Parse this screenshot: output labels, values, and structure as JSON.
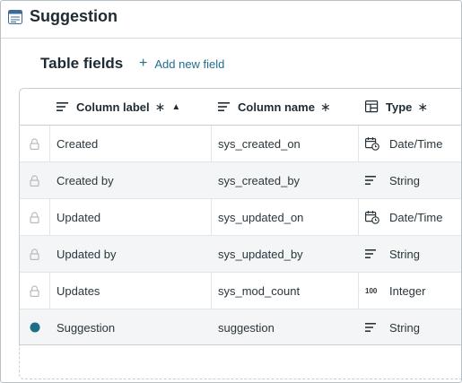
{
  "app": {
    "title": "Suggestion",
    "icon": "table-icon"
  },
  "section": {
    "title": "Table fields",
    "add_label": "Add new field"
  },
  "columns": {
    "label": {
      "text": "Column label",
      "required": "∗",
      "sort": "▲"
    },
    "name": {
      "text": "Column name",
      "required": "∗"
    },
    "type": {
      "text": "Type",
      "required": "∗"
    }
  },
  "rows": [
    {
      "status": "lock-icon",
      "label": "Created",
      "name": "sys_created_on",
      "type": "Date/Time",
      "type_icon": "calendar-clock-icon"
    },
    {
      "status": "lock-icon",
      "label": "Created by",
      "name": "sys_created_by",
      "type": "String",
      "type_icon": "text-lines-icon"
    },
    {
      "status": "lock-icon",
      "label": "Updated",
      "name": "sys_updated_on",
      "type": "Date/Time",
      "type_icon": "calendar-clock-icon"
    },
    {
      "status": "lock-icon",
      "label": "Updated by",
      "name": "sys_updated_by",
      "type": "String",
      "type_icon": "text-lines-icon"
    },
    {
      "status": "lock-icon",
      "label": "Updates",
      "name": "sys_mod_count",
      "type": "Integer",
      "type_icon": "integer-icon",
      "type_icon_text": "100"
    },
    {
      "status": "dot-icon",
      "label": "Suggestion",
      "name": "suggestion",
      "type": "String",
      "type_icon": "text-lines-icon"
    }
  ],
  "colors": {
    "accent": "#1f6f8f",
    "dot": "#1d6f87",
    "shade": "#f3f5f6"
  }
}
